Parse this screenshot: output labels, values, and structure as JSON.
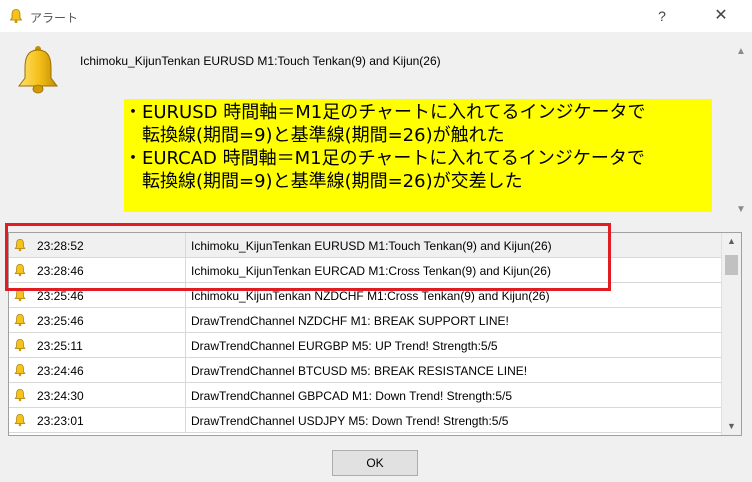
{
  "window": {
    "title": "アラート",
    "help_label": "?",
    "close_label": "✕"
  },
  "message": "Ichimoku_KijunTenkan EURUSD M1:Touch Tenkan(9) and Kijun(26)",
  "callout": {
    "lines": [
      "・EURUSD 時間軸＝M1足のチャートに入れてるインジケータで",
      "　転換線(期間=9)と基準線(期間=26)が触れた",
      "・EURCAD 時間軸＝M1足のチャートに入れてるインジケータで",
      "　転換線(期間=9)と基準線(期間=26)が交差した"
    ],
    "bg_color": "#ffff00"
  },
  "highlight_color": "#e31b23",
  "alerts": [
    {
      "time": "23:28:52",
      "text": "Ichimoku_KijunTenkan EURUSD M1:Touch Tenkan(9) and Kijun(26)"
    },
    {
      "time": "23:28:46",
      "text": "Ichimoku_KijunTenkan EURCAD M1:Cross Tenkan(9) and Kijun(26)"
    },
    {
      "time": "23:25:46",
      "text": "Ichimoku_KijunTenkan NZDCHF M1:Cross Tenkan(9) and Kijun(26)"
    },
    {
      "time": "23:25:46",
      "text": "DrawTrendChannel NZDCHF M1: BREAK SUPPORT LINE!"
    },
    {
      "time": "23:25:11",
      "text": "DrawTrendChannel EURGBP M5: UP Trend! Strength:5/5"
    },
    {
      "time": "23:24:46",
      "text": "DrawTrendChannel BTCUSD M5: BREAK RESISTANCE LINE!"
    },
    {
      "time": "23:24:30",
      "text": "DrawTrendChannel GBPCAD M1: Down Trend! Strength:5/5"
    },
    {
      "time": "23:23:01",
      "text": "DrawTrendChannel USDJPY M5: Down Trend! Strength:5/5"
    }
  ],
  "ok_label": "OK"
}
